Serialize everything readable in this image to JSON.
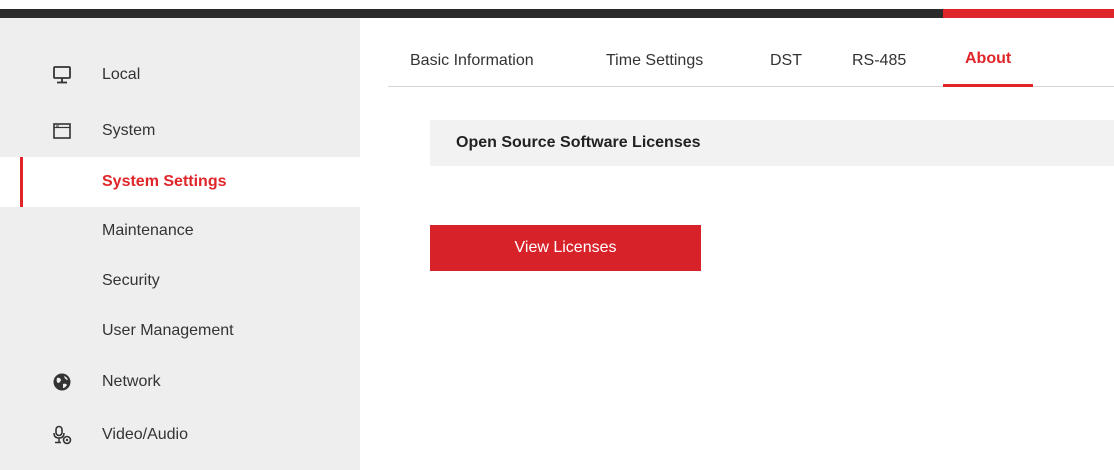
{
  "colors": {
    "accent": "#e0252a",
    "topbar_dark": "#2b2b2b",
    "sidebar_bg": "#eeeeee",
    "section_bg": "#f2f2f2",
    "button_bg": "#d7222a"
  },
  "sidebar": {
    "items": [
      {
        "label": "Local",
        "icon": "monitor-icon"
      },
      {
        "label": "System",
        "icon": "window-icon"
      },
      {
        "label": "System Settings",
        "active": true
      },
      {
        "label": "Maintenance"
      },
      {
        "label": "Security"
      },
      {
        "label": "User Management"
      },
      {
        "label": "Network",
        "icon": "globe-icon"
      },
      {
        "label": "Video/Audio",
        "icon": "microphone-icon"
      }
    ]
  },
  "tabs": [
    {
      "label": "Basic Information"
    },
    {
      "label": "Time Settings"
    },
    {
      "label": "DST"
    },
    {
      "label": "RS-485"
    },
    {
      "label": "About",
      "active": true
    }
  ],
  "main": {
    "section_title": "Open Source Software Licenses",
    "view_licenses_label": "View Licenses"
  }
}
